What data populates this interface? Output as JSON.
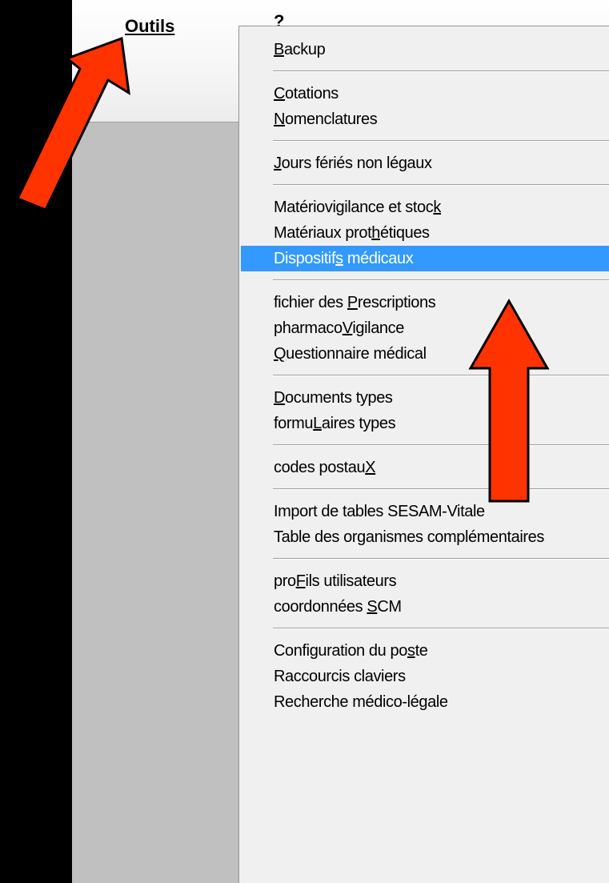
{
  "menubar": {
    "items": [
      {
        "label": "Outils"
      },
      {
        "label": "?"
      }
    ]
  },
  "menu": {
    "groups": [
      [
        {
          "label": "Backup",
          "underline": "B",
          "submenu": true
        }
      ],
      [
        {
          "label": "Cotations",
          "underline": "C",
          "submenu": false
        },
        {
          "label": "Nomenclatures",
          "underline": "N",
          "submenu": true
        }
      ],
      [
        {
          "label": "Jours fériés non légaux",
          "underline": "J",
          "submenu": false
        }
      ],
      [
        {
          "label": "Matériovigilance et stock",
          "underline": "k",
          "submenu": false
        },
        {
          "label": "Matériaux prothétiques",
          "underline": "h",
          "submenu": false
        },
        {
          "label": "Dispositifs médicaux",
          "underline": "s",
          "submenu": false,
          "highlighted": true
        }
      ],
      [
        {
          "label": "fichier des Prescriptions",
          "underline": "P",
          "submenu": false
        },
        {
          "label": "pharmacoVigilance",
          "underline": "V",
          "submenu": false
        },
        {
          "label": "Questionnaire médical",
          "underline": "Q",
          "submenu": false
        }
      ],
      [
        {
          "label": "Documents types",
          "underline": "D",
          "submenu": false
        },
        {
          "label": "formuLaires types",
          "underline": "L",
          "submenu": false
        }
      ],
      [
        {
          "label": "codes postauX",
          "underline": "X",
          "submenu": false
        }
      ],
      [
        {
          "label": "Import de tables SESAM-Vitale",
          "underline": "",
          "submenu": false
        },
        {
          "label": "Table des organismes complémentaires",
          "underline": "",
          "submenu": false
        }
      ],
      [
        {
          "label": "proFils utilisateurs",
          "underline": "F",
          "submenu": false
        },
        {
          "label": "coordonnées SCM",
          "underline": "S",
          "submenu": false
        }
      ],
      [
        {
          "label": "Configuration du poste",
          "underline": "s",
          "submenu": false
        },
        {
          "label": "Raccourcis claviers",
          "underline": "",
          "submenu": false
        },
        {
          "label": "Recherche médico-légale",
          "underline": "",
          "submenu": false
        }
      ]
    ]
  },
  "colors": {
    "highlight": "#3399ff",
    "callout_arrow": "#ff3300",
    "callout_outline": "#000000",
    "menu_background": "#f0f0f0",
    "backdrop": "#000000"
  },
  "callouts": [
    {
      "icon": "red-arrow-icon",
      "points_to": "Outils"
    },
    {
      "icon": "red-arrow-icon",
      "points_to": "Dispositifs médicaux"
    }
  ]
}
